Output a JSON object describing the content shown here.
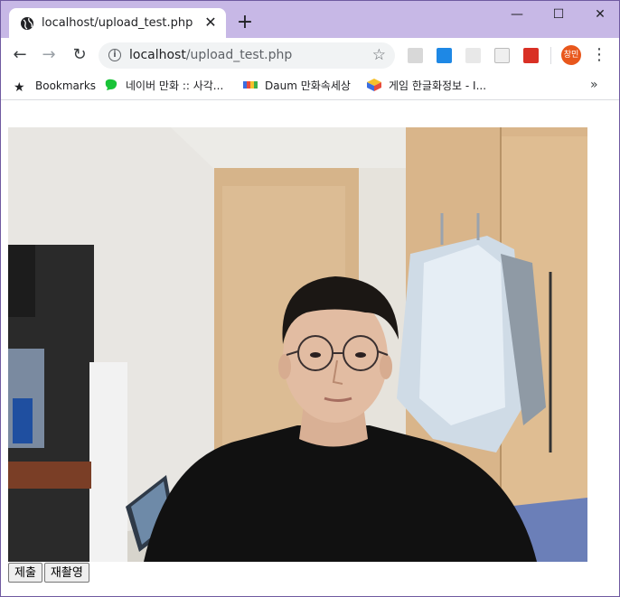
{
  "browser": {
    "tab_title": "localhost/upload_test.php",
    "new_tab_glyph": "+",
    "window_controls": {
      "minimize": "—",
      "maximize": "☐",
      "close": "✕"
    },
    "url_host": "localhost",
    "url_path": "/upload_test.php",
    "profile_initials": "창민"
  },
  "bookmarks": {
    "items": [
      {
        "label": "Bookmarks",
        "icon": "star-icon"
      },
      {
        "label": "네이버 만화 :: 사각...",
        "icon": "naver-comic-icon"
      },
      {
        "label": "Daum 만화속세상",
        "icon": "daum-icon"
      },
      {
        "label": "게임 한글화정보 - I...",
        "icon": "game-box-icon"
      }
    ],
    "more_glyph": "»"
  },
  "page": {
    "image_alt": "webcam capture",
    "buttons": {
      "submit": "제출",
      "retake": "재촬영"
    }
  },
  "colors": {
    "titlebar": "#c7b8e6",
    "omnibox": "#f1f3f4",
    "profile": "#e8571c"
  }
}
